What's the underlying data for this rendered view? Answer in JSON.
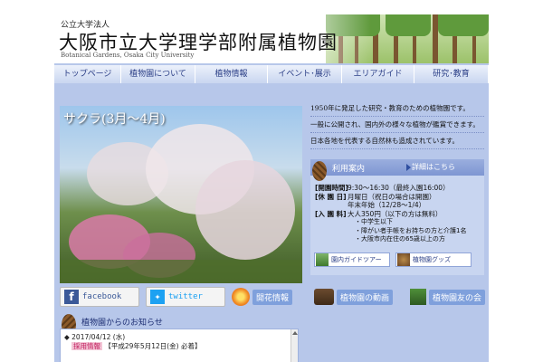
{
  "header": {
    "org_type": "公立大学法人",
    "title": "大阪市立大学理学部附属植物園",
    "subtitle": "Botanical Gardens, Osaka City University"
  },
  "nav": [
    {
      "label": "トップページ"
    },
    {
      "label": "植物園について"
    },
    {
      "label": "植物情報"
    },
    {
      "label": "イベント･展示"
    },
    {
      "label": "エリアガイド"
    },
    {
      "label": "研究･教育"
    }
  ],
  "hero": {
    "title": "サクラ(3月〜4月)"
  },
  "intro": [
    "1950年に発足した研究・教育のための植物園です。",
    "一般に公開され、国内外の様々な植物が鑑賞できます。",
    "日本各地を代表する自然林も造成されています。"
  ],
  "info": {
    "title": "利用案内",
    "detail_link": "詳細はこちら",
    "hours_label": "[開園時間]",
    "hours_value": "9:30〜16:30（最終入園16:00）",
    "closed_label": "[休 園 日]",
    "closed_value": "月曜日（祝日の場合は開園）",
    "closed_value2": "年末年始（12/28〜1/4）",
    "fee_label": "[入 園 料]",
    "fee_value": "大人350円（以下の方は無料）",
    "free_items": [
      "・中学生以下",
      "・障がい者手帳をお持ちの方と介護1名",
      "・大阪市内在住の65歳以上の方"
    ],
    "btn_guide": "園内ガイドツアー",
    "btn_goods": "植物園グッズ"
  },
  "links": {
    "facebook": "facebook",
    "twitter": "twitter",
    "flowering": "開花情報",
    "video": "植物園の動画",
    "friends": "植物園友の会"
  },
  "news": {
    "title": "植物園からのお知らせ",
    "date": "◆ 2017/04/12 (水)",
    "tag": "採用情報",
    "entry": "【平成29年5月12日(金) 必着】"
  },
  "colors": {
    "page_bg": "#b7c7ea",
    "nav_text": "#2a3e86",
    "facebook": "#3b5998",
    "twitter": "#1da1f2"
  }
}
